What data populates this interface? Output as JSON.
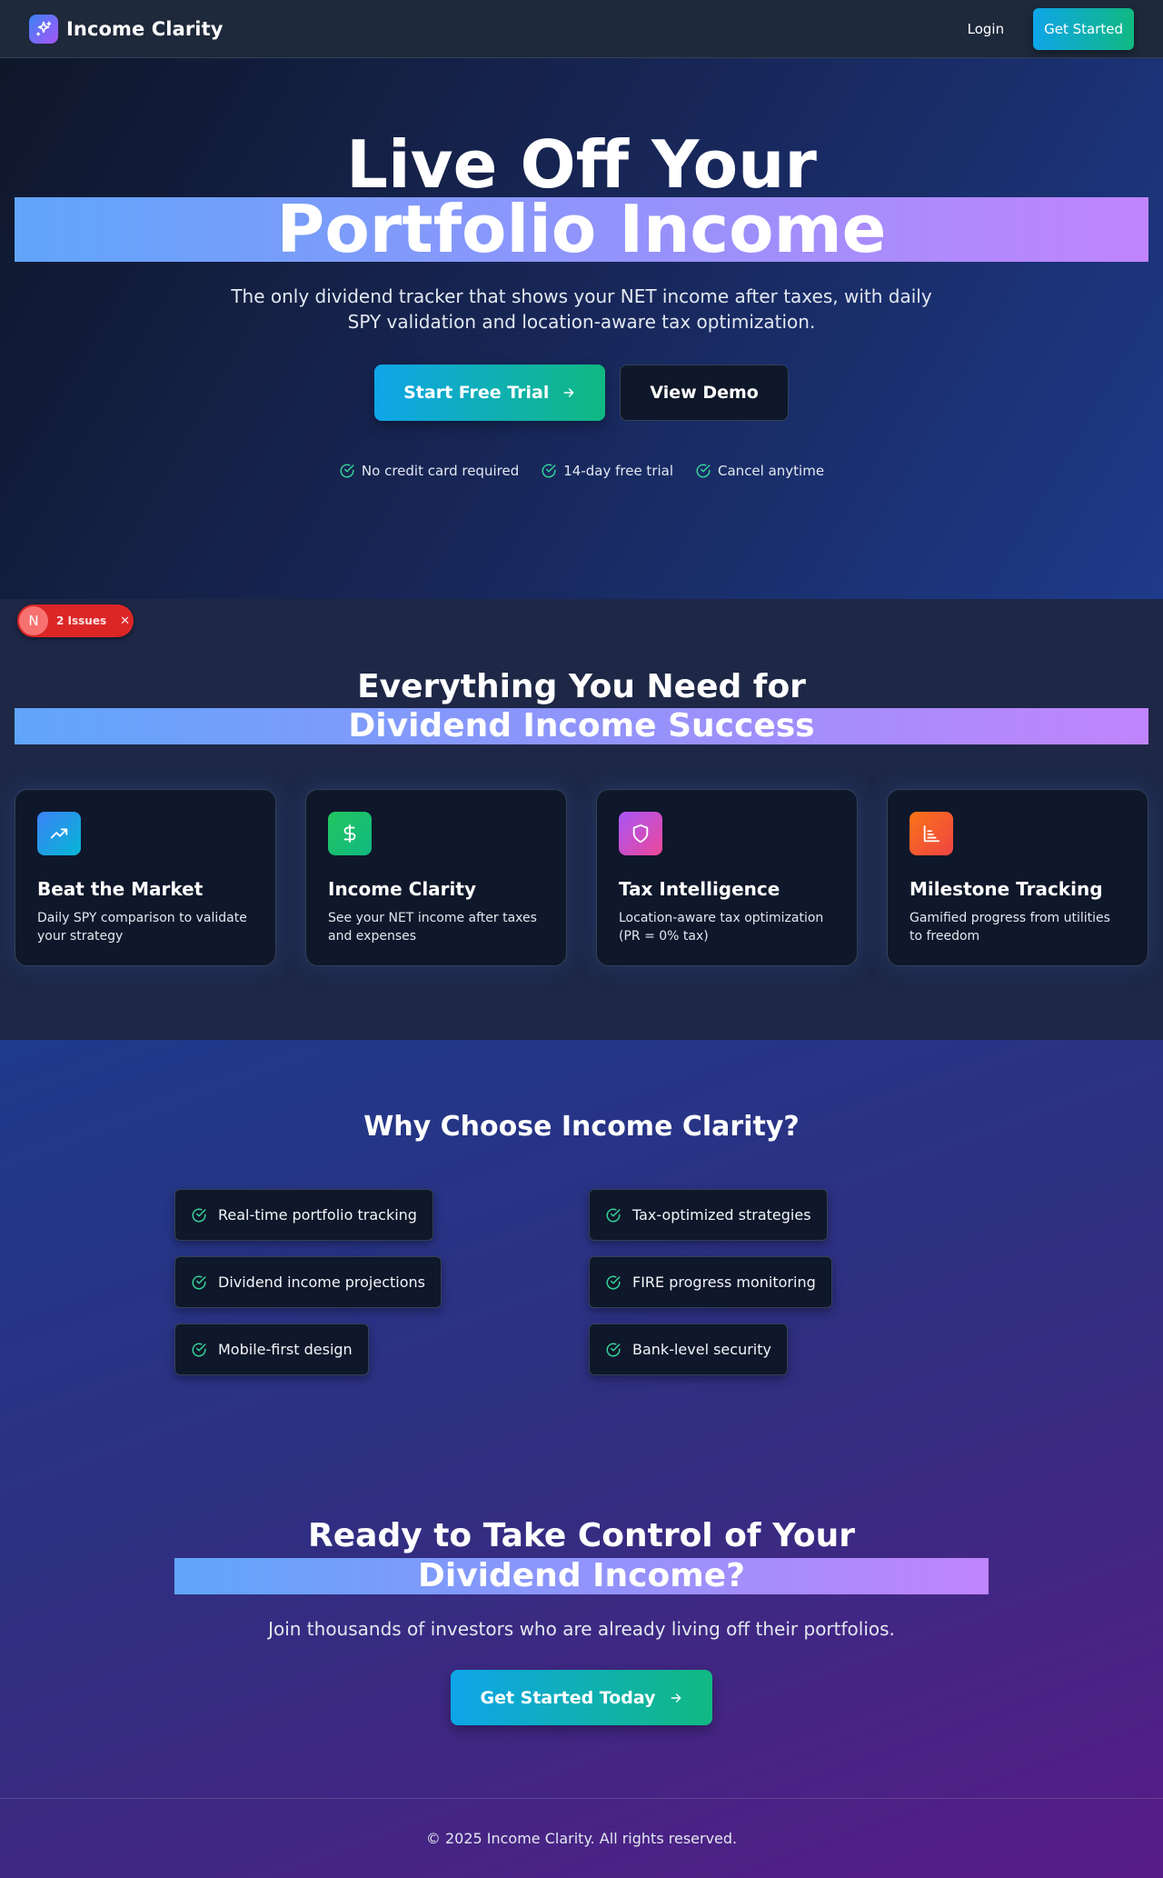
{
  "nav": {
    "brand": "Income Clarity",
    "login": "Login",
    "get_started": "Get Started"
  },
  "hero": {
    "title_line1": "Live Off Your",
    "title_line2": "Portfolio Income",
    "subtitle": "The only dividend tracker that shows your NET income after taxes, with daily SPY validation and location-aware tax optimization.",
    "primary_cta": "Start Free Trial",
    "secondary_cta": "View Demo",
    "assurances": [
      "No credit card required",
      "14-day free trial",
      "Cancel anytime"
    ]
  },
  "dev_overlay": {
    "letter": "N",
    "issues_label": "2 Issues"
  },
  "features": {
    "title_line1": "Everything You Need for",
    "title_line2": "Dividend Income Success",
    "cards": [
      {
        "title": "Beat the Market",
        "description": "Daily SPY comparison to validate your strategy",
        "icon": "trending-up-icon",
        "color_from": "#3b82f6",
        "color_to": "#06b6d4"
      },
      {
        "title": "Income Clarity",
        "description": "See your NET income after taxes and expenses",
        "icon": "dollar-icon",
        "color_from": "#22c55e",
        "color_to": "#10b981"
      },
      {
        "title": "Tax Intelligence",
        "description": "Location-aware tax optimization (PR = 0% tax)",
        "icon": "shield-icon",
        "color_from": "#a855f7",
        "color_to": "#ec4899"
      },
      {
        "title": "Milestone Tracking",
        "description": "Gamified progress from utilities to freedom",
        "icon": "bar-chart-icon",
        "color_from": "#f97316",
        "color_to": "#ef4444"
      }
    ]
  },
  "why": {
    "title": "Why Choose Income Clarity?",
    "items": [
      "Real-time portfolio tracking",
      "Tax-optimized strategies",
      "Dividend income projections",
      "FIRE progress monitoring",
      "Mobile-first design",
      "Bank-level security"
    ]
  },
  "cta": {
    "title_line1": "Ready to Take Control of Your",
    "title_line2": "Dividend Income?",
    "subtitle": "Join thousands of investors who are already living off their portfolios.",
    "button": "Get Started Today"
  },
  "footer": {
    "copyright": "© 2025 Income Clarity. All rights reserved."
  },
  "colors": {
    "accent_start": "#0ea5e9",
    "accent_end": "#10b981",
    "gradient_text_start": "#60a5fa",
    "gradient_text_end": "#c084fc",
    "check": "#34d399"
  }
}
